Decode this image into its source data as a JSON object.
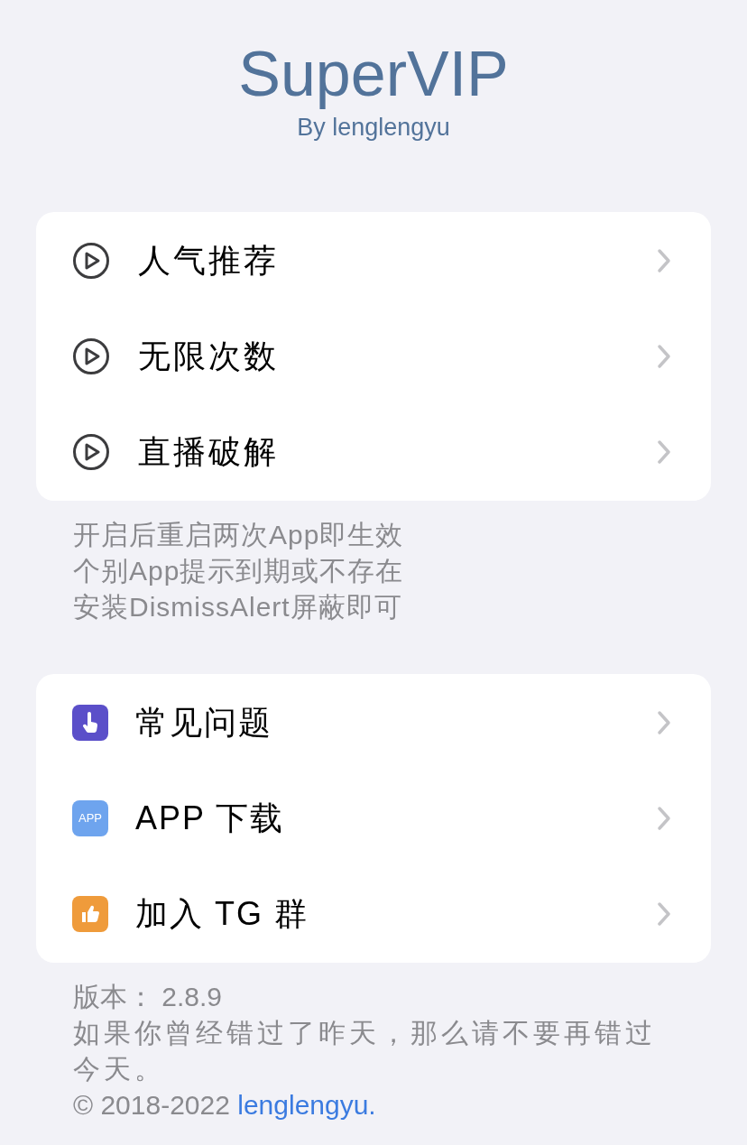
{
  "header": {
    "title": "SuperVIP",
    "subtitle": "By lenglengyu"
  },
  "feature_list": [
    {
      "label": "人气推荐"
    },
    {
      "label": "无限次数"
    },
    {
      "label": "直播破解"
    }
  ],
  "notes": [
    "开启后重启两次App即生效",
    "个别App提示到期或不存在",
    "安装DismissAlert屏蔽即可"
  ],
  "links_list": [
    {
      "label": "常见问题",
      "kind": "pointer",
      "color": "#5b4fc9"
    },
    {
      "label": "APP 下载",
      "kind": "text",
      "icon_text": "APP",
      "color": "#6ea4ee"
    },
    {
      "label": "加入 TG 群",
      "kind": "thumb",
      "color": "#ef9b3b"
    }
  ],
  "footer": {
    "version": "版本： 2.8.9",
    "motto": "如果你曾经错过了昨天，那么请不要再错过今天。",
    "copyright": "© 2018-2022 ",
    "author_link": "lenglengyu."
  }
}
